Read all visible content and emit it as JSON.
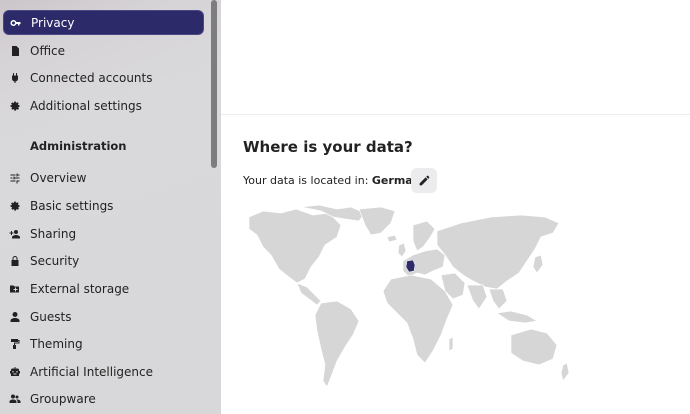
{
  "sidebar": {
    "personal_items": [
      {
        "label": "Privacy",
        "icon": "key-icon",
        "active": true
      },
      {
        "label": "Office",
        "icon": "document-icon"
      },
      {
        "label": "Connected accounts",
        "icon": "plug-icon"
      },
      {
        "label": "Additional settings",
        "icon": "cog-icon"
      }
    ],
    "admin_heading": "Administration",
    "admin_items": [
      {
        "label": "Overview",
        "icon": "tune-icon"
      },
      {
        "label": "Basic settings",
        "icon": "cog-icon"
      },
      {
        "label": "Sharing",
        "icon": "share-person-icon"
      },
      {
        "label": "Security",
        "icon": "lock-icon"
      },
      {
        "label": "External storage",
        "icon": "folder-plus-icon"
      },
      {
        "label": "Guests",
        "icon": "person-icon"
      },
      {
        "label": "Theming",
        "icon": "paint-roller-icon"
      },
      {
        "label": "Artificial Intelligence",
        "icon": "robot-icon"
      },
      {
        "label": "Groupware",
        "icon": "group-icon"
      }
    ]
  },
  "main": {
    "title": "Where is your data?",
    "location_prefix": "Your data is located in: ",
    "location_country": "Germany",
    "location_suffix": ".",
    "edit_icon": "pencil-icon"
  },
  "colors": {
    "accent": "#2d2a6a",
    "map_land": "#d6d6d6",
    "map_highlight": "#2d2a6a"
  }
}
